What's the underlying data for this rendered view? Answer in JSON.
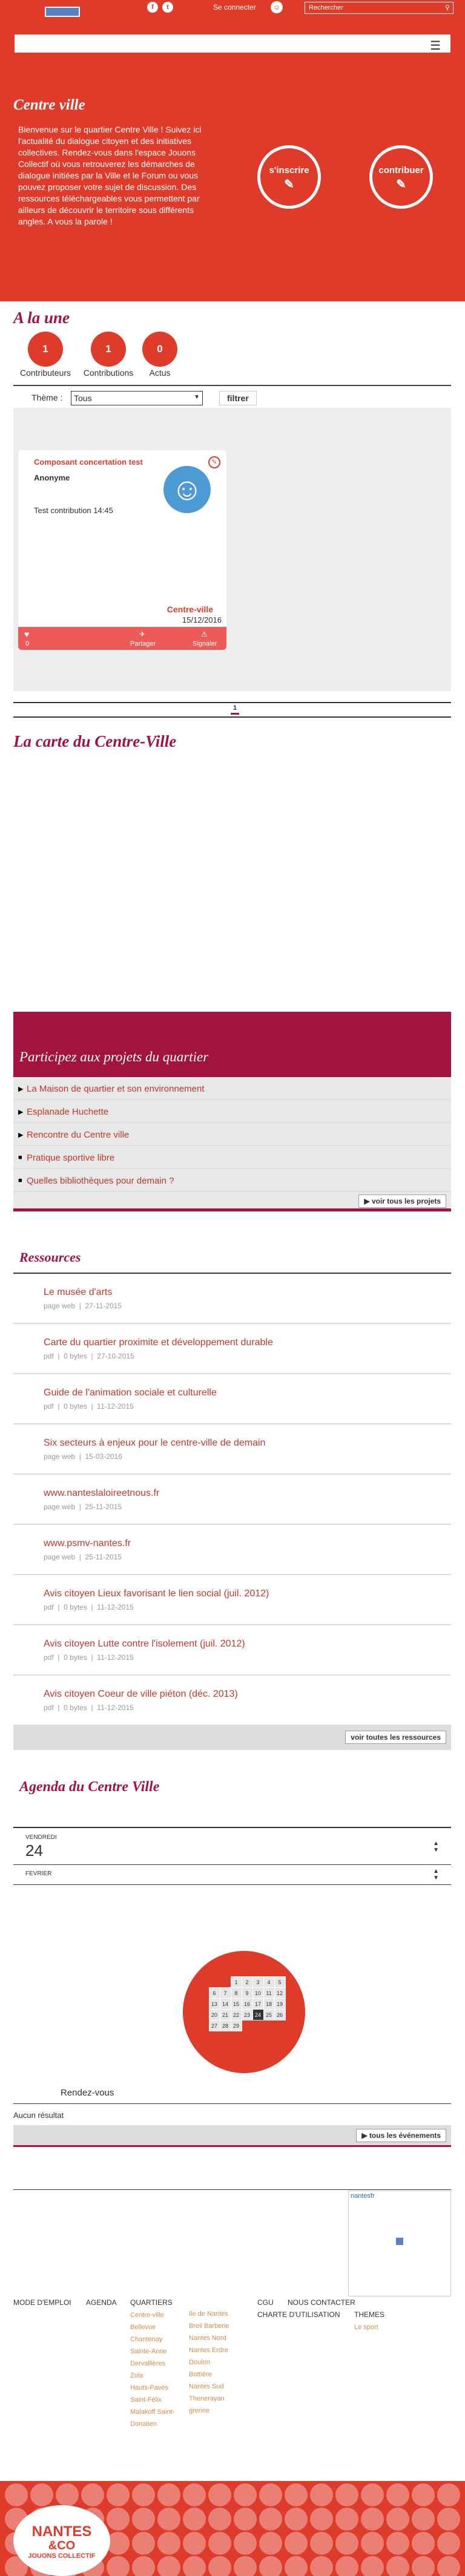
{
  "header": {
    "connect_label": "Se connecter",
    "search_placeholder": "Rechercher",
    "social": [
      "f",
      "t"
    ]
  },
  "hero": {
    "title": "Centre ville",
    "text": "Bienvenue sur le quartier Centre Ville ! Suivez ici l'actualité du dialogue citoyen et des initiatives collectives. Rendez-vous dans l'espace Jouons Collectif où vous retrouverez les démarches de dialogue initiées par la Ville et le Forum ou vous pouvez proposer votre sujet de discussion. Des ressources téléchargeables vous permettent par ailleurs de découvrir le territoire sous différents angles. A vous la parole !",
    "btn_signup": "s'inscrire",
    "btn_contribute": "contribuer"
  },
  "une": {
    "title": "A la une",
    "stats": [
      {
        "num": "1",
        "label": "Contributeurs"
      },
      {
        "num": "1",
        "label": "Contributions"
      },
      {
        "num": "0",
        "label": "Actus"
      }
    ],
    "theme_label": "Thème :",
    "theme_value": "Tous",
    "filter_btn": "filtrer"
  },
  "card": {
    "title": "Composant concertation test",
    "author": "Anonyme",
    "text": "Test contribution 14:45",
    "place": "Centre-ville",
    "date": "15/12/2016",
    "likes": "0",
    "share": "Partager",
    "report": "Signaler"
  },
  "pagination": {
    "page": "1"
  },
  "map": {
    "title": "La carte du Centre-Ville"
  },
  "projects": {
    "title": "Participez aux projets du quartier",
    "items": [
      "La Maison de quartier et son environnement",
      "Esplanade Huchette",
      "Rencontre du Centre ville",
      "Pratique sportive libre",
      "Quelles bibliothèques pour demain ?"
    ],
    "more": "voir tous les projets"
  },
  "resources": {
    "title": "Ressources",
    "items": [
      {
        "title": "Le musée d'arts",
        "type": "page web",
        "size": "",
        "date": "27-11-2015"
      },
      {
        "title": "Carte du quartier proximite et développement durable",
        "type": "pdf",
        "size": "0 bytes",
        "date": "27-10-2015"
      },
      {
        "title": "Guide de l'animation sociale et culturelle",
        "type": "pdf",
        "size": "0 bytes",
        "date": "11-12-2015"
      },
      {
        "title": "Six secteurs à enjeux pour le centre-ville de demain",
        "type": "page web",
        "size": "",
        "date": "15-03-2016"
      },
      {
        "title": "www.nanteslaloireetnous.fr",
        "type": "page web",
        "size": "",
        "date": "25-11-2015"
      },
      {
        "title": "www.psmv-nantes.fr",
        "type": "page web",
        "size": "",
        "date": "25-11-2015"
      },
      {
        "title": "Avis citoyen Lieux favorisant le lien social (juil. 2012)",
        "type": "pdf",
        "size": "0 bytes",
        "date": "11-12-2015"
      },
      {
        "title": "Avis citoyen Lutte contre l'isolement (juil. 2012)",
        "type": "pdf",
        "size": "0 bytes",
        "date": "11-12-2015"
      },
      {
        "title": "Avis citoyen Coeur de ville piéton (déc. 2013)",
        "type": "pdf",
        "size": "0 bytes",
        "date": "11-12-2015"
      }
    ],
    "more": "voir toutes les ressources"
  },
  "agenda": {
    "title": "Agenda du Centre Ville",
    "day_name": "VENDREDI",
    "day_num": "24",
    "month": "FEVRIER",
    "calendar": [
      [
        "",
        "",
        "",
        "1",
        "2",
        "3",
        "4",
        "5"
      ],
      [
        "6",
        "7",
        "8",
        "9",
        "10",
        "11",
        "12"
      ],
      [
        "13",
        "14",
        "15",
        "16",
        "17",
        "18",
        "19"
      ],
      [
        "20",
        "21",
        "22",
        "23",
        "24",
        "25",
        "26"
      ],
      [
        "27",
        "28",
        "29"
      ]
    ],
    "selected": "24",
    "rdv": "Rendez-vous",
    "no_result": "Aucun résultat",
    "more": "tous les événements"
  },
  "footer": {
    "map_label": "nantesfr",
    "cols": [
      {
        "head": "MODE D'EMPLOI",
        "items": []
      },
      {
        "head": "AGENDA",
        "items": []
      },
      {
        "head": "QUARTIERS",
        "items": [
          "Centre-ville",
          "Bellevue",
          "Chantenay",
          "Sainte-Anne",
          "Dervallières",
          "Zola",
          "Hauts-Pavés",
          "Saint-Félix",
          "Malakoff Saint-",
          "Donatien"
        ]
      },
      {
        "head": "",
        "items": [
          "Ile de Nantes",
          "Breil Barberie",
          "Nantes Nord",
          "Nantes Erdre",
          "Doulon",
          "Bottière",
          "Nantes Sud",
          "Thenerayan",
          "grenne"
        ]
      },
      {
        "head": "CGU",
        "items": []
      },
      {
        "head": "NOUS CONTACTER",
        "items": []
      },
      {
        "head": "CHARTE D'UTILISATION",
        "items": []
      },
      {
        "head": "THEMES",
        "items": [
          "Le sport"
        ]
      }
    ]
  },
  "logo": {
    "line1": "NANTES",
    "line2": "&CO",
    "line3": "JOUONS COLLECTIF"
  }
}
